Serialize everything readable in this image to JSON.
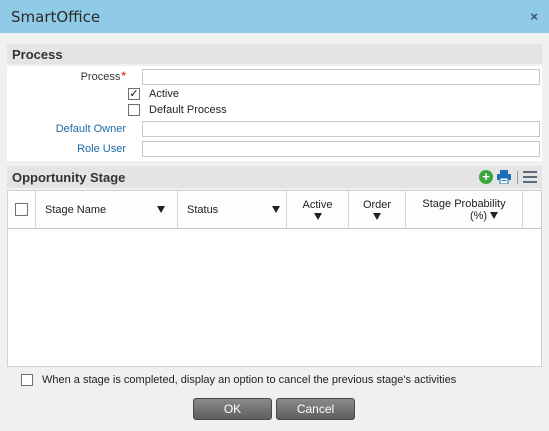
{
  "window": {
    "title": "SmartOffice",
    "close_icon": "×"
  },
  "process": {
    "section_label": "Process",
    "process_label": "Process",
    "required_mark": "*",
    "process_value": "",
    "active_label": "Active",
    "active_checked": true,
    "default_process_label": "Default Process",
    "default_process_checked": false,
    "default_owner_label": "Default Owner",
    "default_owner_value": "",
    "role_user_label": "Role User",
    "role_user_value": ""
  },
  "opportunity_stage": {
    "section_label": "Opportunity Stage",
    "toolbar_icons": [
      "add-icon",
      "print-icon",
      "menu-icon"
    ],
    "columns": [
      {
        "label": "Stage Name"
      },
      {
        "label": "Status"
      },
      {
        "label": "Active"
      },
      {
        "label": "Order"
      },
      {
        "label_line1": "Stage Probability",
        "label_line2": "(%)"
      }
    ],
    "rows": []
  },
  "options": {
    "cancel_previous_label": "When a stage is completed, display an option to cancel the previous stage's activities",
    "cancel_previous_checked": false
  },
  "buttons": {
    "ok_label": "OK",
    "cancel_label": "Cancel"
  }
}
